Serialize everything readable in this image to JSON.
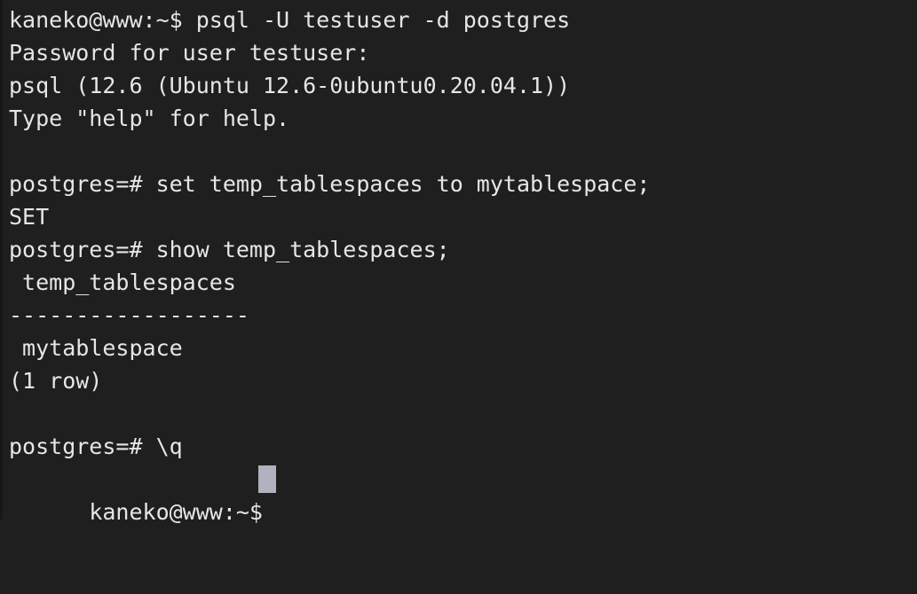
{
  "terminal": {
    "app": "terminal-emulator",
    "colors": {
      "background": "#1f1f1f",
      "foreground": "#e6e6e6",
      "cursor": "#b0b2bf",
      "edge_strip": "#161616"
    },
    "shell_prompt": "kaneko@www:~$",
    "psql_prompt": "postgres=#",
    "cursor": {
      "style": "block",
      "column": 14,
      "row": 14,
      "visible": true
    },
    "lines": [
      {
        "id": "line-1",
        "text": "kaneko@www:~$ psql -U testuser -d postgres"
      },
      {
        "id": "line-2",
        "text": "Password for user testuser:"
      },
      {
        "id": "line-3",
        "text": "psql (12.6 (Ubuntu 12.6-0ubuntu0.20.04.1))"
      },
      {
        "id": "line-4",
        "text": "Type \"help\" for help."
      },
      {
        "id": "line-5",
        "text": ""
      },
      {
        "id": "line-6",
        "text": "postgres=# set temp_tablespaces to mytablespace;"
      },
      {
        "id": "line-7",
        "text": "SET"
      },
      {
        "id": "line-8",
        "text": "postgres=# show temp_tablespaces;"
      },
      {
        "id": "line-9",
        "text": " temp_tablespaces"
      },
      {
        "id": "line-10",
        "text": "------------------"
      },
      {
        "id": "line-11",
        "text": " mytablespace"
      },
      {
        "id": "line-12",
        "text": "(1 row)"
      },
      {
        "id": "line-13",
        "text": ""
      },
      {
        "id": "line-14",
        "text": "postgres=# \\q"
      }
    ],
    "last_line": {
      "id": "line-15",
      "text": "kaneko@www:~$ "
    },
    "session": {
      "command_invoked": "psql -U testuser -d postgres",
      "password_prompt": "Password for user testuser:",
      "psql_version": "12.6",
      "distribution_build": "Ubuntu 12.6-0ubuntu0.20.04.1",
      "help_hint": "Type \"help\" for help.",
      "set_command": "set temp_tablespaces to mytablespace;",
      "set_result": "SET",
      "show_command": "show temp_tablespaces;",
      "result_column_header": "temp_tablespaces",
      "result_value": "mytablespace",
      "row_count_label": "(1 row)",
      "quit_command": "\\q"
    }
  }
}
